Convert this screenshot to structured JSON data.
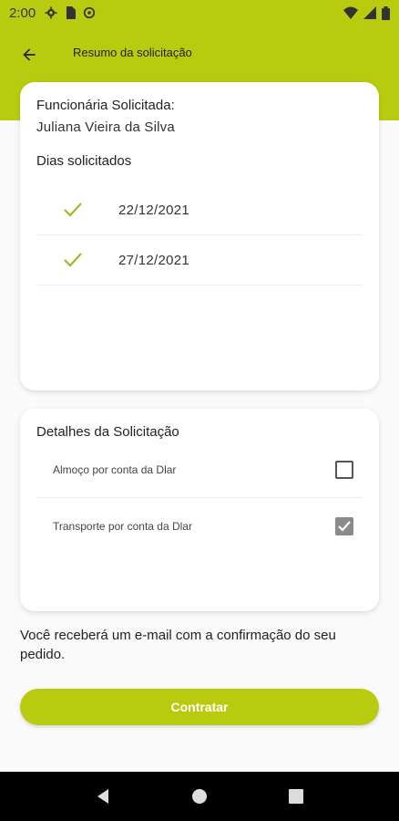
{
  "status_bar": {
    "time": "2:00"
  },
  "header": {
    "title": "Resumo da solicitação"
  },
  "summary": {
    "employee_label": "Funcionária Solicitada:",
    "employee_name": "Juliana Vieira da Silva",
    "days_label": "Dias solicitados",
    "days": [
      {
        "date": "22/12/2021"
      },
      {
        "date": "27/12/2021"
      }
    ]
  },
  "details": {
    "title": "Detalhes da Solicitação",
    "options": [
      {
        "label": "Almoço por conta da Dlar",
        "checked": false
      },
      {
        "label": "Transporte por conta da Dlar",
        "checked": true
      }
    ]
  },
  "info": {
    "text": "Você receberá um e-mail com a confirmação do seu pedido."
  },
  "actions": {
    "submit_label": "Contratar"
  },
  "colors": {
    "accent": "#b9cb0e",
    "check": "#9bbd22"
  }
}
